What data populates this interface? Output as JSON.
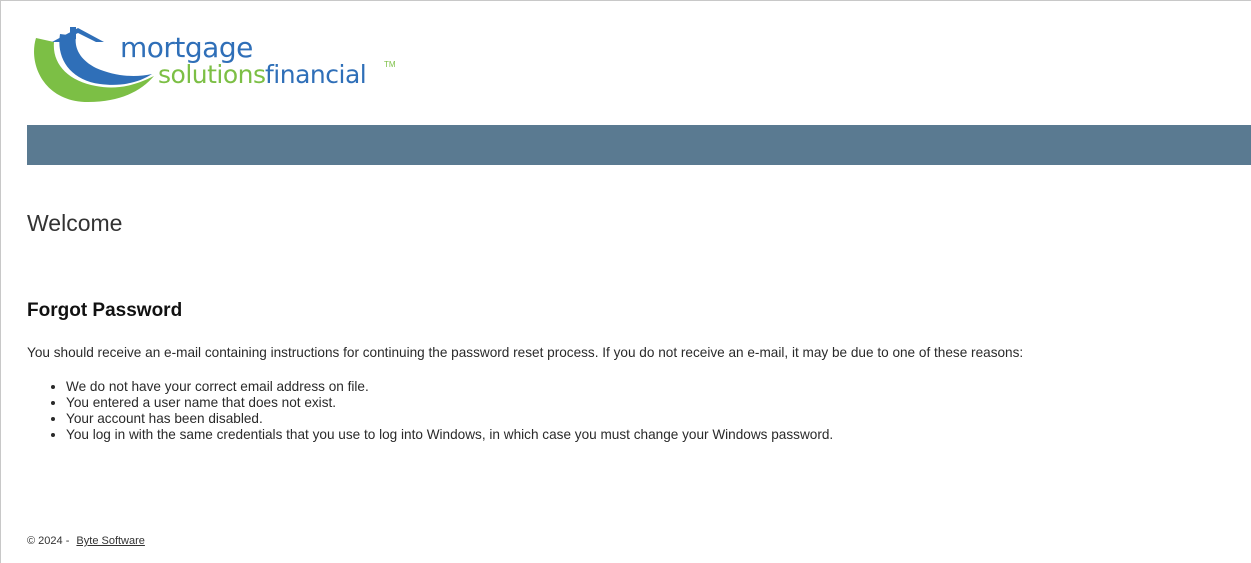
{
  "header": {
    "logo": {
      "word_mortgage": "mortgage",
      "word_solutions": "solutions",
      "word_financial": "financial",
      "tm": "TM",
      "colors": {
        "blue": "#2f6fb8",
        "green": "#7cbf45"
      }
    },
    "banner_color": "#5a7a91"
  },
  "main": {
    "welcome": "Welcome",
    "forgot_password": {
      "title": "Forgot Password",
      "intro": "You should receive an e-mail containing instructions for continuing the password reset process. If you do not receive an e-mail, it may be due to one of these reasons:",
      "reasons": [
        "We do not have your correct email address on file.",
        "You entered a user name that does not exist.",
        "Your account has been disabled.",
        "You log in with the same credentials that you use to log into Windows, in which case you must change your Windows password."
      ]
    }
  },
  "footer": {
    "copyright": "© 2024 -",
    "link_label": "Byte Software"
  }
}
